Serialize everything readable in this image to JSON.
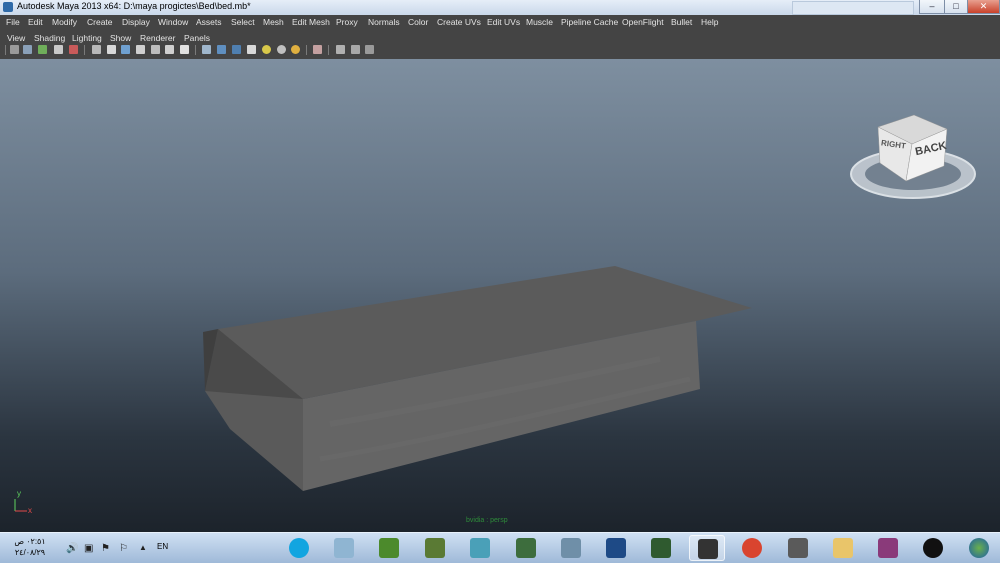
{
  "window": {
    "title": "Autodesk Maya 2013 x64: D:\\maya progictes\\Bed\\bed.mb*",
    "minimize_label": "–",
    "maximize_label": "□",
    "close_label": "✕"
  },
  "menubar": {
    "items": [
      "File",
      "Edit",
      "Modify",
      "Create",
      "Display",
      "Window",
      "Assets",
      "Select",
      "Mesh",
      "Edit Mesh",
      "Proxy",
      "Normals",
      "Color",
      "Create UVs",
      "Edit UVs",
      "Muscle",
      "Pipeline Cache",
      "OpenFlight",
      "Bullet",
      "Help"
    ]
  },
  "panel_menu": {
    "items": [
      "View",
      "Shading",
      "Lighting",
      "Show",
      "Renderer",
      "Panels"
    ]
  },
  "toolbar": {
    "icons": [
      "select-camera-icon",
      "camera-attributes-icon",
      "bookmark-icon",
      "image-plane-icon",
      "2d-pan-zoom-icon",
      "grid-icon",
      "film-gate-icon",
      "resolution-gate-icon",
      "gate-mask-icon",
      "field-chart-icon",
      "safe-action-icon",
      "safe-title-icon",
      "wireframe-icon",
      "smooth-shade-icon",
      "smooth-shade-all-icon",
      "textured-icon",
      "use-all-lights-icon",
      "shadows-icon",
      "xray-icon",
      "isolate-select-icon",
      "xray-joints-icon",
      "xray-components-icon"
    ]
  },
  "viewport": {
    "viewcube": {
      "face_right": "RIGHT",
      "face_back": "BACK"
    },
    "axis": {
      "x": "x",
      "y": "y"
    },
    "camera_label": "bvidia : persp"
  },
  "taskbar": {
    "clock_time": "٠٢:٥١ ص",
    "clock_date": "٢٤/٠٨/٢٩",
    "language": "EN",
    "tray_icons": [
      "volume-icon",
      "network-icon",
      "action-center-icon",
      "flag-icon",
      "show-hidden-icon"
    ],
    "apps": [
      {
        "name": "skype",
        "color": "#12a5e0"
      },
      {
        "name": "file-manager",
        "color": "#8fb5d2"
      },
      {
        "name": "minecraft",
        "color": "#4c8a2c"
      },
      {
        "name": "minecraft-2",
        "color": "#5a7a34"
      },
      {
        "name": "maya",
        "color": "#4aa0b8"
      },
      {
        "name": "tool",
        "color": "#3d6d3d"
      },
      {
        "name": "y-tool",
        "color": "#6f8fa8"
      },
      {
        "name": "photoshop",
        "color": "#1e4a86"
      },
      {
        "name": "editor",
        "color": "#2f5a2f"
      },
      {
        "name": "maya-active",
        "color": "#333333"
      },
      {
        "name": "chrome",
        "color": "#d9442f"
      },
      {
        "name": "graphics-tool",
        "color": "#5a5a5a"
      },
      {
        "name": "folder",
        "color": "#e9c56a"
      },
      {
        "name": "winrar",
        "color": "#8a3a7a"
      },
      {
        "name": "udk",
        "color": "#111111"
      }
    ],
    "start_label": "Start"
  },
  "colors": {
    "maya_ui": "#444444",
    "viewport_top": "#7e8fa0",
    "viewport_bottom": "#1c232b",
    "mesh": "#555555",
    "taskbar": "#b3cbe6"
  }
}
